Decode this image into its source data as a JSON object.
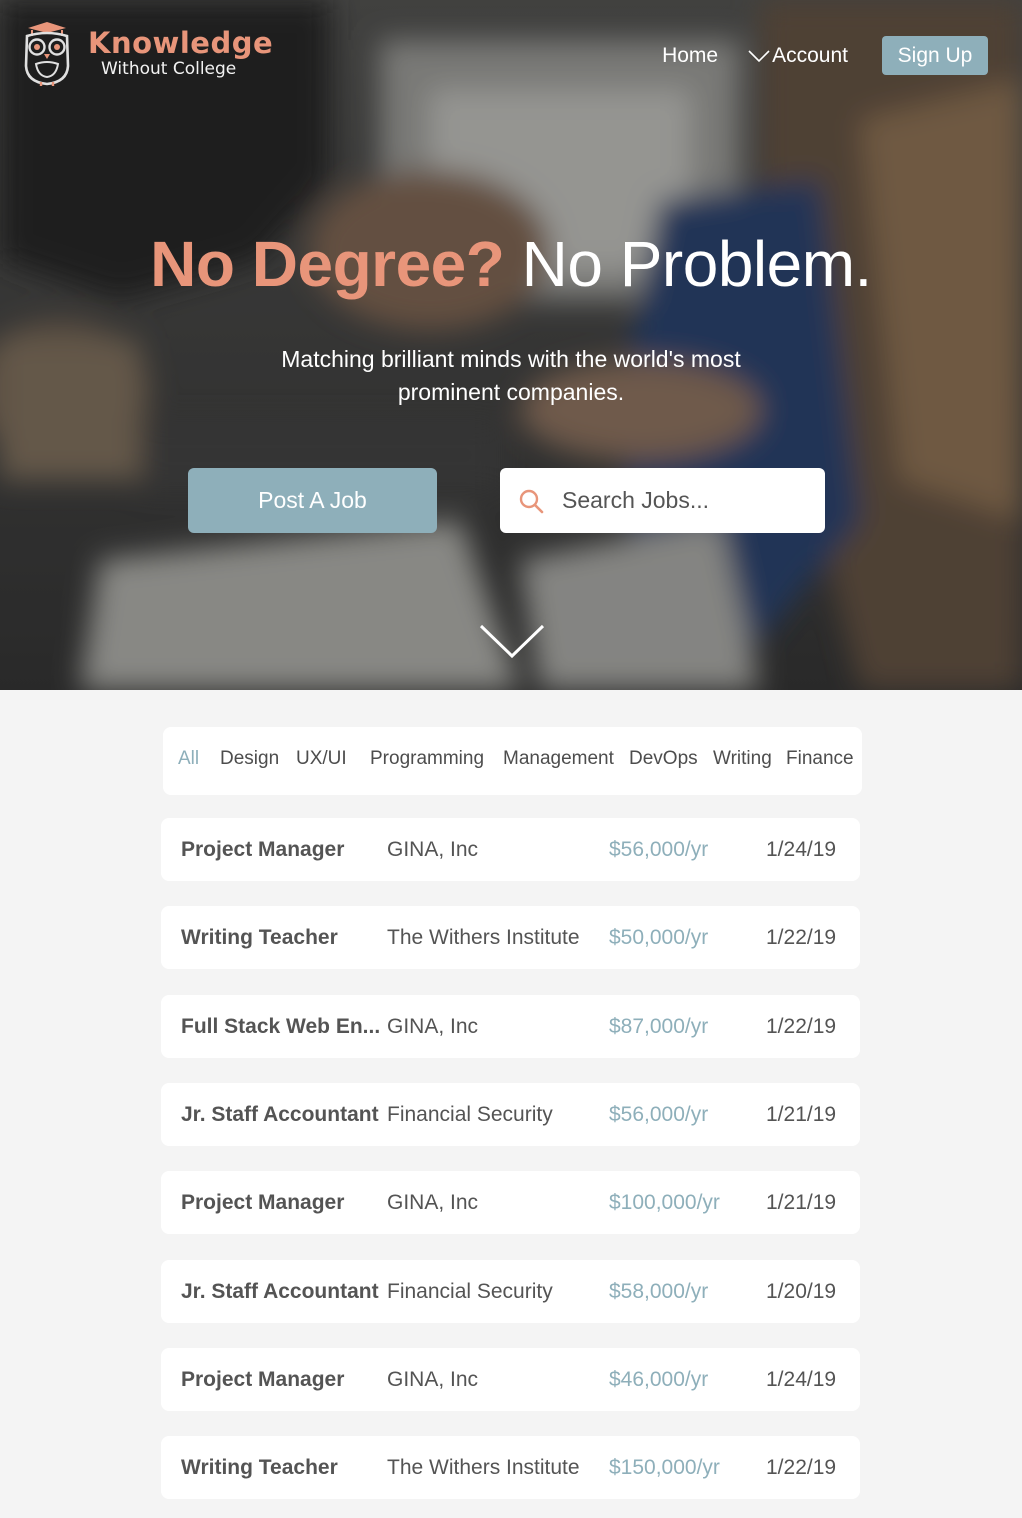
{
  "brand": {
    "title": "Knowledge",
    "subtitle": "Without College",
    "accent_color": "#e8957a"
  },
  "nav": {
    "home": "Home",
    "account": "Account",
    "signup": "Sign Up",
    "button_color": "#8eafba"
  },
  "hero": {
    "headline_accent": "No Degree?",
    "headline_rest": "No Problem.",
    "subhead": "Matching brilliant minds with the world's most prominent companies.",
    "post_job": "Post A Job",
    "search_placeholder": "Search Jobs...",
    "search_icon": "search-icon",
    "scroll_icon": "chevron-down-icon"
  },
  "filters": [
    "All",
    "Design",
    "UX/UI",
    "Programming",
    "Management",
    "DevOps",
    "Writing",
    "Finance"
  ],
  "active_filter": "All",
  "jobs": [
    {
      "title": "Project Manager",
      "company": "GINA, Inc",
      "salary": "$56,000/yr",
      "date": "1/24/19"
    },
    {
      "title": "Writing Teacher",
      "company": "The Withers Institute",
      "salary": "$50,000/yr",
      "date": "1/22/19"
    },
    {
      "title": "Full Stack Web En...",
      "company": "GINA, Inc",
      "salary": "$87,000/yr",
      "date": "1/22/19"
    },
    {
      "title": "Jr. Staff Accountant",
      "company": "Financial Security",
      "salary": "$56,000/yr",
      "date": "1/21/19"
    },
    {
      "title": "Project Manager",
      "company": "GINA, Inc",
      "salary": "$100,000/yr",
      "date": "1/21/19"
    },
    {
      "title": "Jr. Staff Accountant",
      "company": "Financial Security",
      "salary": "$58,000/yr",
      "date": "1/20/19"
    },
    {
      "title": "Project Manager",
      "company": "GINA, Inc",
      "salary": "$46,000/yr",
      "date": "1/24/19"
    },
    {
      "title": "Writing Teacher",
      "company": "The Withers Institute",
      "salary": "$150,000/yr",
      "date": "1/22/19"
    }
  ]
}
